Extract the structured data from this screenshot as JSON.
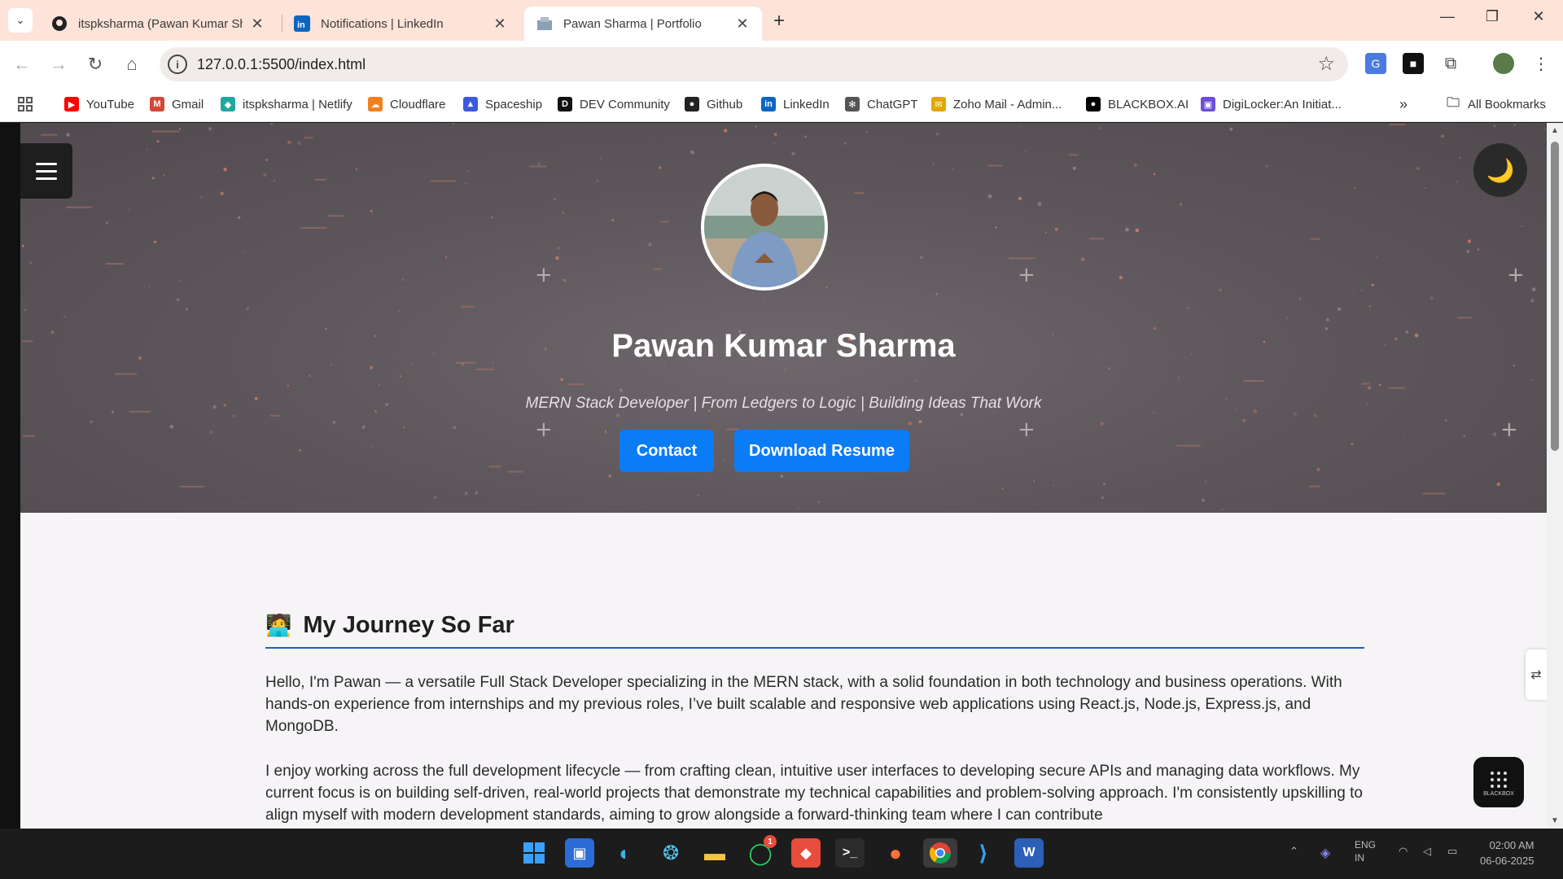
{
  "browser": {
    "tabs": [
      {
        "title": "itspksharma (Pawan Kumar Sha",
        "icon": "github-icon",
        "active": false
      },
      {
        "title": "Notifications | LinkedIn",
        "icon": "linkedin-icon",
        "active": false
      },
      {
        "title": "Pawan Sharma | Portfolio",
        "icon": "portfolio-icon",
        "active": true
      }
    ],
    "url": "127.0.0.1:5500/index.html",
    "bookmarks": [
      {
        "label": "YouTube",
        "color": "#ff0000",
        "glyph": "▶"
      },
      {
        "label": "Gmail",
        "color": "#d44638",
        "glyph": "M"
      },
      {
        "label": "itspksharma | Netlify",
        "color": "#20a8a0",
        "glyph": "◆"
      },
      {
        "label": "Cloudflare",
        "color": "#f38020",
        "glyph": "☁"
      },
      {
        "label": "Spaceship",
        "color": "#3b5bdb",
        "glyph": "▲"
      },
      {
        "label": "DEV Community",
        "color": "#111111",
        "glyph": "D"
      },
      {
        "label": "Github",
        "color": "#222222",
        "glyph": "●"
      },
      {
        "label": "LinkedIn",
        "color": "#0a66c2",
        "glyph": "in"
      },
      {
        "label": "ChatGPT",
        "color": "#555555",
        "glyph": "✻"
      },
      {
        "label": "Zoho Mail - Admin...",
        "color": "#e0a800",
        "glyph": "✉"
      },
      {
        "label": "BLACKBOX.AI",
        "color": "#000000",
        "glyph": "●"
      },
      {
        "label": "DigiLocker:An Initiat...",
        "color": "#6c4fd6",
        "glyph": "▣"
      }
    ],
    "all_bookmarks_label": "All Bookmarks"
  },
  "hero": {
    "name": "Pawan Kumar Sharma",
    "tagline": "MERN Stack Developer | From Ledgers to Logic | Building Ideas That Work",
    "contact_label": "Contact",
    "resume_label": "Download Resume",
    "theme_icon": "moon-icon"
  },
  "journey": {
    "emoji": "🧑‍💻",
    "title": "My Journey So Far",
    "paragraphs": [
      "Hello, I'm Pawan — a versatile Full Stack Developer specializing in the MERN stack, with a solid foundation in both technology and business operations. With hands-on experience from internships and my previous roles, I’ve built scalable and responsive web applications using React.js, Node.js, Express.js, and MongoDB.",
      "I enjoy working across the full development lifecycle — from crafting clean, intuitive user interfaces to developing secure APIs and managing data workflows. My current focus is on building self-driven, real-world projects that demonstrate my technical capabilities and problem-solving approach. I'm consistently upskilling to align myself with modern development standards, aiming to grow alongside a forward-thinking team where I can contribute"
    ]
  },
  "widgets": {
    "blackbox_label": "BLACKBOX"
  },
  "taskbar": {
    "whatsapp_badge": "1",
    "lang_line1": "ENG",
    "lang_line2": "IN",
    "time": "02:00 AM",
    "date": "06-06-2025"
  },
  "colors": {
    "accent": "#0a7cf5",
    "section_rule": "#1565c0"
  }
}
